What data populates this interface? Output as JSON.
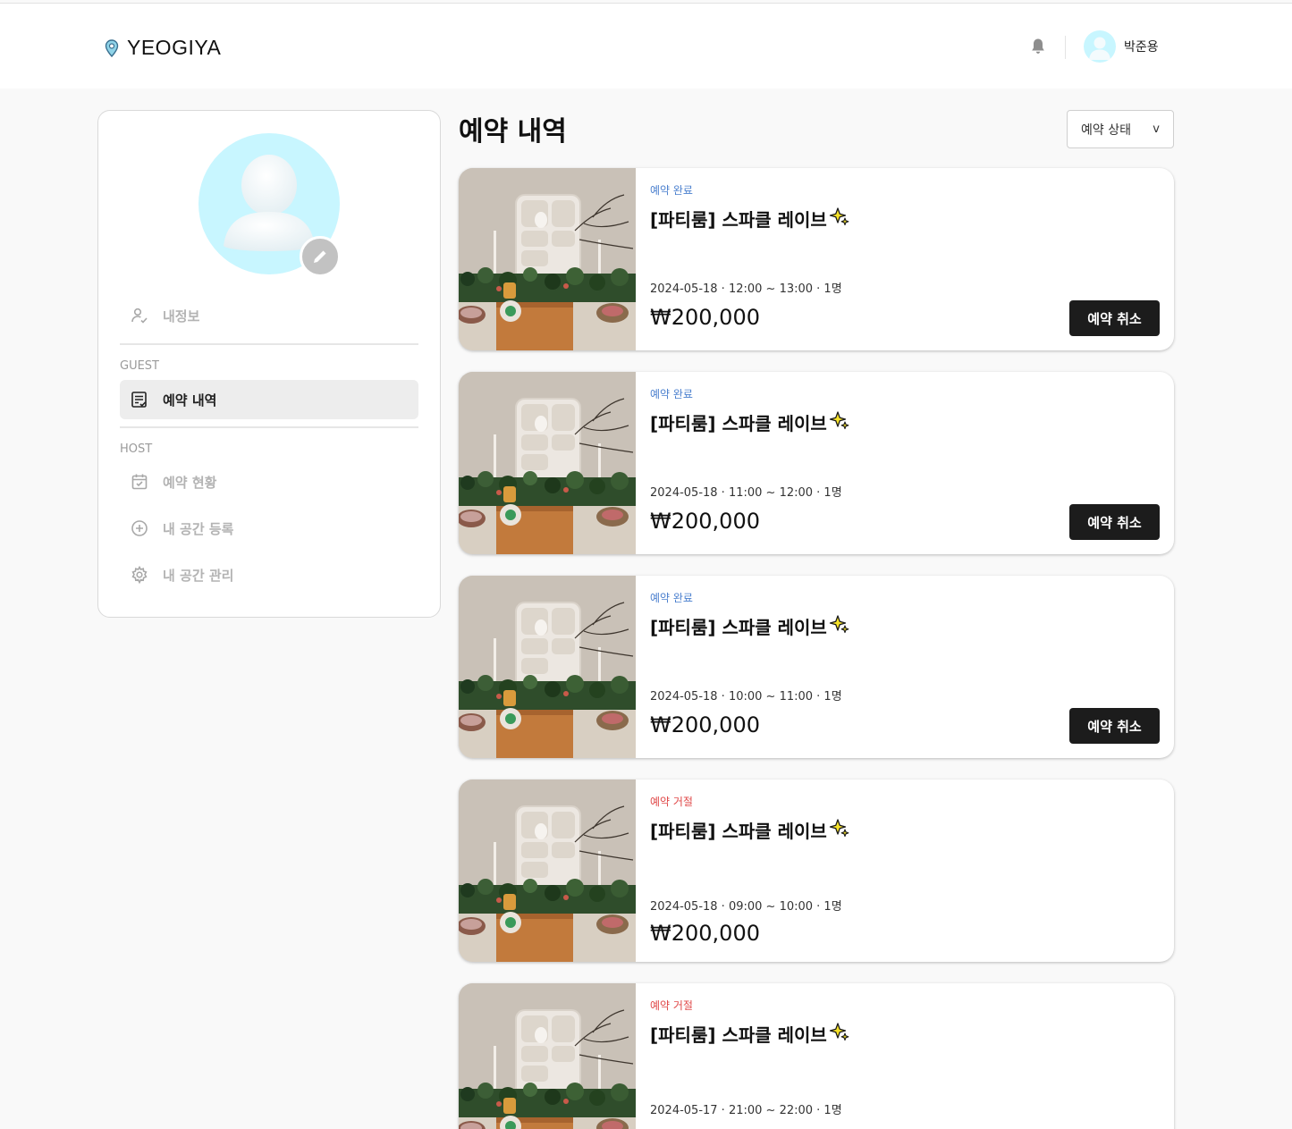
{
  "header": {
    "logo_text": "YEOGIYA",
    "user_name": "박준용"
  },
  "sidebar": {
    "items": {
      "my_info": "내정보",
      "guest_section": "GUEST",
      "reservations": "예약 내역",
      "host_section": "HOST",
      "reservation_status": "예약 현황",
      "register_space": "내 공간 등록",
      "manage_space": "내 공간 관리"
    }
  },
  "main": {
    "title": "예약 내역",
    "filter_label": "예약 상태",
    "filter_chevron": "v",
    "cancel_label": "예약 취소",
    "cards": [
      {
        "status": "예약 완료",
        "status_type": "ok",
        "title": "[파티룸] 스파클 레이브",
        "meta": "2024-05-18 · 12:00 ~ 13:00 · 1명",
        "price": "₩200,000",
        "cancelable": true
      },
      {
        "status": "예약 완료",
        "status_type": "ok",
        "title": "[파티룸] 스파클 레이브",
        "meta": "2024-05-18 · 11:00 ~ 12:00 · 1명",
        "price": "₩200,000",
        "cancelable": true
      },
      {
        "status": "예약 완료",
        "status_type": "ok",
        "title": "[파티룸] 스파클 레이브",
        "meta": "2024-05-18 · 10:00 ~ 11:00 · 1명",
        "price": "₩200,000",
        "cancelable": true
      },
      {
        "status": "예약 거절",
        "status_type": "rejected",
        "title": "[파티룸] 스파클 레이브",
        "meta": "2024-05-18 · 09:00 ~ 10:00 · 1명",
        "price": "₩200,000",
        "cancelable": false
      },
      {
        "status": "예약 거절",
        "status_type": "rejected",
        "title": "[파티룸] 스파클 레이브",
        "meta": "2024-05-17 · 21:00 ~ 22:00 · 1명",
        "price": "",
        "cancelable": false
      }
    ]
  },
  "colors": {
    "status_ok": "#4a7fce",
    "status_rejected": "#e04848",
    "button_dark": "#1c1c1c",
    "avatar_bg": "#c8f6ff"
  }
}
